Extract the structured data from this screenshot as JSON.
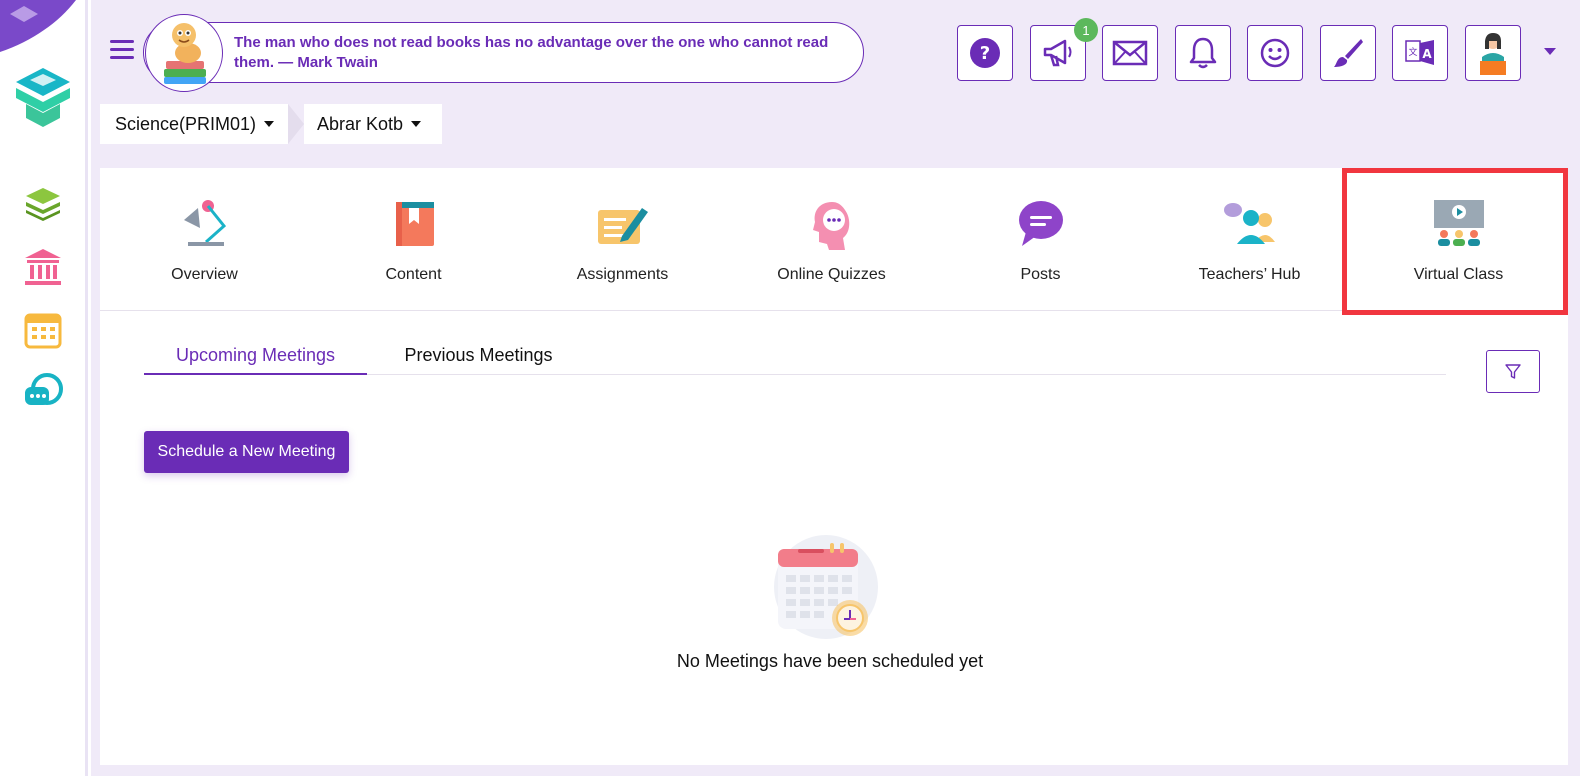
{
  "quote": {
    "text": "The man who does not read books has no advantage over the one who cannot read them. — Mark Twain"
  },
  "topbar": {
    "buttons": [
      {
        "name": "help-icon"
      },
      {
        "name": "megaphone-icon"
      },
      {
        "name": "mail-icon"
      },
      {
        "name": "bell-icon"
      },
      {
        "name": "smiley-icon"
      },
      {
        "name": "paintbrush-icon"
      },
      {
        "name": "translate-icon"
      },
      {
        "name": "profile-avatar"
      }
    ],
    "announcement_badge": "1"
  },
  "breadcrumb": {
    "subject": "Science(PRIM01)",
    "student": "Abrar Kotb"
  },
  "nav": {
    "items": [
      {
        "label": "Overview"
      },
      {
        "label": "Content"
      },
      {
        "label": "Assignments"
      },
      {
        "label": "Online Quizzes"
      },
      {
        "label": "Posts"
      },
      {
        "label": "Teachers’ Hub"
      },
      {
        "label": "Virtual Class"
      }
    ]
  },
  "tabs": {
    "upcoming": "Upcoming Meetings",
    "previous": "Previous Meetings"
  },
  "actions": {
    "schedule": "Schedule a New Meeting"
  },
  "empty_state": {
    "message": "No Meetings have been scheduled yet"
  },
  "colors": {
    "primary": "#6a2cb6",
    "background": "#f0eaf8",
    "highlight": "#f1363f",
    "badge": "#5cb85c"
  }
}
